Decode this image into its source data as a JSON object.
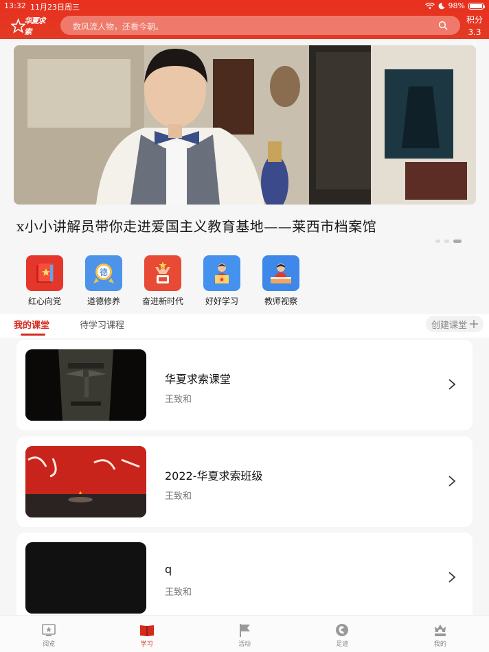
{
  "status": {
    "time": "13:32",
    "date": "11月23日周三",
    "battery": "98%",
    "battery_level": 0.98
  },
  "header": {
    "logo_text": "华夏求索",
    "search_placeholder": "数风流人物，还看今朝。",
    "points_label": "积分",
    "points_value": "3.3 千"
  },
  "banner": {
    "title": "x小小讲解员带你走进爱国主义教育基地——莱西市档案馆",
    "dots": 3,
    "active_dot": 3
  },
  "categories": [
    {
      "label": "红心向党",
      "icon": "party-book-icon",
      "color": "#e23a2f"
    },
    {
      "label": "道德修养",
      "icon": "virtue-medal-icon",
      "color": "#4a8fe6"
    },
    {
      "label": "奋进新时代",
      "icon": "striving-figure-icon",
      "color": "#e84d3a"
    },
    {
      "label": "好好学习",
      "icon": "student-reading-icon",
      "color": "#3f8be8"
    },
    {
      "label": "教师视察",
      "icon": "teacher-desk-icon",
      "color": "#3b86e6"
    }
  ],
  "tabs": {
    "active": "我的课堂",
    "pending": "待学习课程",
    "create": "创建课堂"
  },
  "courses": [
    {
      "title": "华夏求索课堂",
      "teacher": "王致和",
      "thumb": "bronze-mask"
    },
    {
      "title": "2022-华夏求索班级",
      "teacher": "王致和",
      "thumb": "calligraphy"
    },
    {
      "title": "q",
      "teacher": "王致和",
      "thumb": "blank"
    }
  ],
  "nav": [
    {
      "label": "阅览",
      "icon": "browse-icon",
      "active": false
    },
    {
      "label": "学习",
      "icon": "study-book-icon",
      "active": true
    },
    {
      "label": "活动",
      "icon": "activity-flag-icon",
      "active": false
    },
    {
      "label": "足迹",
      "icon": "footprint-icon",
      "active": false
    },
    {
      "label": "我的",
      "icon": "profile-icon",
      "active": false
    }
  ],
  "colors": {
    "brand_red": "#e2311f",
    "accent_red": "#d42a1e"
  }
}
